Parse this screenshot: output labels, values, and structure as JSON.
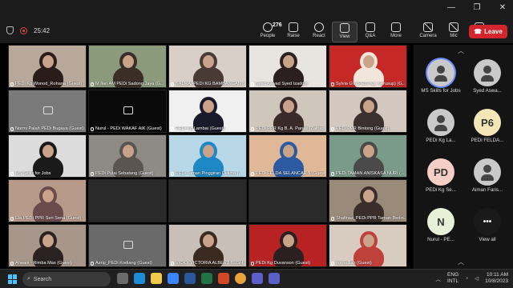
{
  "window": {
    "controls": [
      "minimize",
      "maximize",
      "close"
    ]
  },
  "status": {
    "timer": "25:42"
  },
  "toolbar": {
    "items": [
      {
        "label": "People",
        "count": "276",
        "icon": "people-icon"
      },
      {
        "label": "Raise",
        "icon": "raise-hand-icon"
      },
      {
        "label": "React",
        "icon": "react-icon"
      },
      {
        "label": "View",
        "icon": "view-icon",
        "active": true
      },
      {
        "label": "Q&A",
        "icon": "qa-icon"
      },
      {
        "label": "More",
        "icon": "more-icon"
      },
      {
        "label": "Camera",
        "icon": "camera-icon"
      },
      {
        "label": "Mic",
        "icon": "mic-icon"
      },
      {
        "label": "Share",
        "icon": "share-icon"
      }
    ],
    "leave_label": "Leave"
  },
  "video_grid": {
    "tiles": [
      {
        "name": "PEDi Kg Wonod_Rohana (Guest)",
        "bg": "#b8a89a",
        "person": "#2a1c18"
      },
      {
        "name": "M Ilan AM PEDi Sadong Jaya (G...",
        "bg": "#8a9a7a",
        "person": "#3a2e26"
      },
      {
        "name": "SALMA -PEDi KG BAMBANGAN (...",
        "bg": "#d8d0c8",
        "person": "#4a3a36"
      },
      {
        "name": "Syed Aswad Syed Izaddin",
        "bg": "#e8e4e0",
        "person": "#2a2020"
      },
      {
        "name": "Sylvia GV (PEDi Kg. Serusup) (G...",
        "bg": "#c62828",
        "person": "#f0e6dc"
      },
      {
        "name": "Normi Palah PEDi Bugaya (Guest)",
        "bg": "#7a7a7a",
        "person": ""
      },
      {
        "name": "Nurul - PEDi WAKAF AIK (Guest)",
        "bg": "#0a0a0a",
        "person": ""
      },
      {
        "name": "PEDi Kg Lambai (Guest)",
        "bg": "#f0f0f0",
        "person": "#1a1a2a"
      },
      {
        "name": "PEDi PPR Kg B. A. Panas (Zainab...",
        "bg": "#cfc6bc",
        "person": "#3a2a2a"
      },
      {
        "name": "PEDi PPR Bintong (Guest)",
        "bg": "#d2c8c0",
        "person": "#3a3030"
      },
      {
        "name": "MS Skills for Jobs",
        "bg": "#dcdcdc",
        "person": "#1a1a1a"
      },
      {
        "name": "PEDi Pulai Sebatang (Guest)",
        "bg": "#8e8a86",
        "person": "#5a5550"
      },
      {
        "name": "PEDi Taman Pinggiran Delima (...",
        "bg": "#b8d8e8",
        "person": "#1e88c4"
      },
      {
        "name": "PEDi FELDA SELANCAR 5 (Guest)",
        "bg": "#e0b898",
        "person": "#2c5aa0"
      },
      {
        "name": "PEDi TAMAN ANISKASA NURI (...",
        "bg": "#7a9a8a",
        "person": "#4a4a4a"
      },
      {
        "name": "Aheani - Rimba Mas (Guest)",
        "bg": "#a8968a",
        "person": "#2a2220"
      },
      {
        "name": "Azrip_PEDi Kodiang (Guest)",
        "bg": "#6a6a6a",
        "person": ""
      },
      {
        "name": "VICKY VICTORIA ALBERT BUSH...",
        "bg": "#c8c0b8",
        "person": "#3a2a20"
      },
      {
        "name": "PEDi Kg Duvanson (Guest)",
        "bg": "#b82222",
        "person": "#2a2020"
      },
      {
        "name": "norfadilah (Guest)",
        "bg": "#d8ccc0",
        "person": "#c0403c"
      },
      {
        "name": "Efa PEDI PPR Seri Sena (Guest)",
        "bg": "#b89a8a",
        "person": "#6a4a4a"
      },
      {
        "name": "Shafinaz_PEDi PPR Taman Berlin...",
        "bg": "#9a8a7a",
        "person": "#3a2e2a"
      }
    ]
  },
  "sidebar": {
    "participants": [
      {
        "name": "MS Skills for Jobs",
        "initials": "",
        "color": "",
        "selected": true
      },
      {
        "name": "Syed Aswa...",
        "initials": "",
        "color": ""
      },
      {
        "name": "PEDi Kg La...",
        "initials": "",
        "color": ""
      },
      {
        "name": "PEDi FELDA...",
        "initials": "P6",
        "color": "#f5e6b8"
      },
      {
        "name": "PEDi Kg Se...",
        "initials": "PD",
        "color": "#f5cfc6"
      },
      {
        "name": "Aiman Faris...",
        "initials": "",
        "color": ""
      },
      {
        "name": "Nurul - PE...",
        "initials": "N",
        "color": "#e8f0d8"
      },
      {
        "name": "View all",
        "initials": "",
        "color": ""
      }
    ]
  },
  "taskbar": {
    "search_placeholder": "Search",
    "lang": "ENG",
    "region": "INTL",
    "time": "10:11 AM",
    "date": "10/8/2023"
  }
}
